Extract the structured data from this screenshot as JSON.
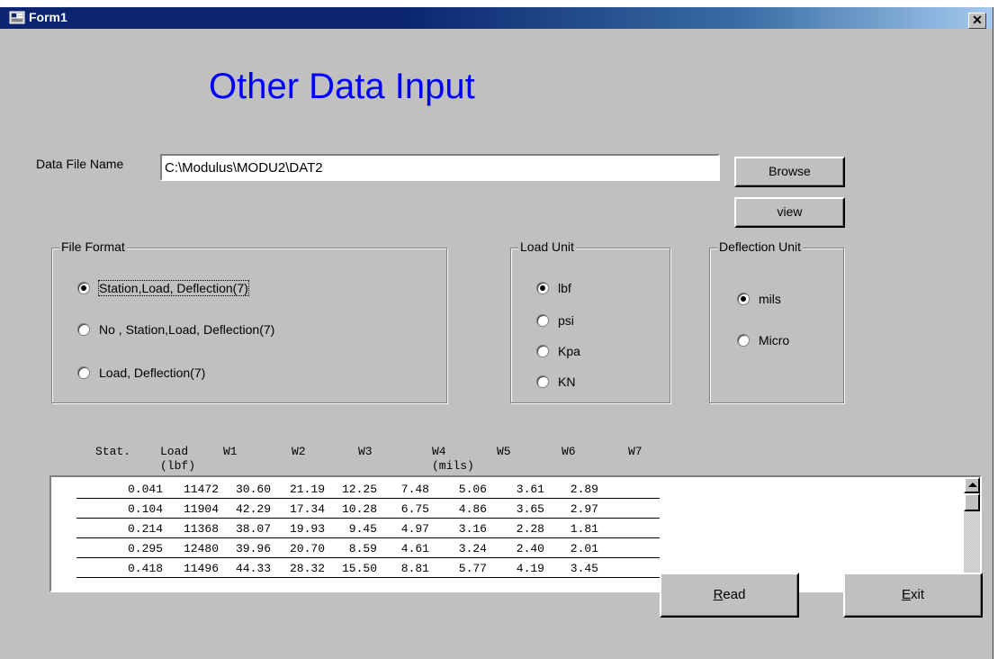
{
  "window": {
    "title": "Form1",
    "close_glyph": "✕"
  },
  "heading": "Other Data Input",
  "data_file": {
    "label": "Data File Name",
    "value": "C:\\Modulus\\MODU2\\DAT2"
  },
  "buttons": {
    "browse": "Browse",
    "view": "view",
    "read_accel": "R",
    "read_rest": "ead",
    "exit_accel": "E",
    "exit_rest": "xit"
  },
  "file_format": {
    "title": "File Format",
    "options": [
      {
        "label": "Station,Load, Deflection(7)",
        "checked": true
      },
      {
        "label": "No ,  Station,Load, Deflection(7)",
        "checked": false
      },
      {
        "label": "Load, Deflection(7)",
        "checked": false
      }
    ]
  },
  "load_unit": {
    "title": "Load Unit",
    "options": [
      {
        "label": "lbf",
        "checked": true
      },
      {
        "label": "psi",
        "checked": false
      },
      {
        "label": "Kpa",
        "checked": false
      },
      {
        "label": "KN",
        "checked": false
      }
    ]
  },
  "deflection_unit": {
    "title": "Deflection Unit",
    "options": [
      {
        "label": "mils",
        "checked": true
      },
      {
        "label": "Micro",
        "checked": false
      }
    ]
  },
  "table": {
    "headers": [
      "Stat.",
      "Load",
      "W1",
      "W2",
      "W3",
      "W4",
      "W5",
      "W6",
      "W7"
    ],
    "units": {
      "load": "(lbf)",
      "deflection": "(mils)"
    },
    "rows": [
      [
        "0.041",
        "11472",
        "30.60",
        "21.19",
        "12.25",
        "7.48",
        "5.06",
        "3.61",
        "2.89"
      ],
      [
        "0.104",
        "11904",
        "42.29",
        "17.34",
        "10.28",
        "6.75",
        "4.86",
        "3.65",
        "2.97"
      ],
      [
        "0.214",
        "11368",
        "38.07",
        "19.93",
        "9.45",
        "4.97",
        "3.16",
        "2.28",
        "1.81"
      ],
      [
        "0.295",
        "12480",
        "39.96",
        "20.70",
        "8.59",
        "4.61",
        "3.24",
        "2.40",
        "2.01"
      ],
      [
        "0.418",
        "11496",
        "44.33",
        "28.32",
        "15.50",
        "8.81",
        "5.77",
        "4.19",
        "3.45"
      ]
    ]
  }
}
